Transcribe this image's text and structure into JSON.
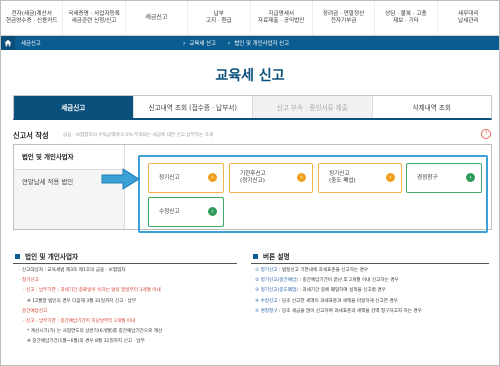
{
  "topnav": [
    {
      "line1": "전자(세금)계산서",
      "line2": "현금영수증 · 신용카드"
    },
    {
      "line1": "국세증명 · 사업자등록",
      "line2": "세금관련 신청/신고"
    },
    {
      "line1": "세금신고",
      "line2": ""
    },
    {
      "line1": "납부",
      "line2": "고지 · 환급"
    },
    {
      "line1": "지급명세서",
      "line2": "자료제출 · 공익법인"
    },
    {
      "line1": "장려금 · 연말정산",
      "line2": "전자기부금"
    },
    {
      "line1": "상담 · 불복 · 고충",
      "line2": "제보 · 기타"
    },
    {
      "line1": "세무대리",
      "line2": "납세관리"
    }
  ],
  "breadcrumb": {
    "home_icon": "home-icon",
    "items": [
      "세금신고",
      "교육세 신고",
      "법인 및 개인사업자 신고"
    ]
  },
  "page_title": "교육세 신고",
  "tabs": [
    {
      "label": "세금신고",
      "state": "active"
    },
    {
      "label": "신고내역 조회 (접수증 · 납부서)",
      "state": "normal"
    },
    {
      "label": "신고 부속 · 증빙서류 제출",
      "state": "disabled"
    },
    {
      "label": "삭제내역 조회",
      "state": "normal"
    }
  ],
  "section": {
    "title": "신고서 작성",
    "note": "금융 · 보험업자의 수익금액에 0.5% 부과되는 세금에 대한 신고 납부하는 조세",
    "help_icon": "?"
  },
  "sidebar": [
    {
      "label": "법인 및 개인사업자",
      "active": true
    },
    {
      "label": "연말납세 적용 법인",
      "active": false
    }
  ],
  "options": [
    {
      "line1": "정기신고",
      "line2": "",
      "color": "orange"
    },
    {
      "line1": "기한후신고",
      "line2": "(정기신고)",
      "color": "orange"
    },
    {
      "line1": "정기신고",
      "line2": "(중도 폐업)",
      "color": "orange"
    },
    {
      "line1": "경정청구",
      "line2": "",
      "color": "green"
    },
    {
      "line1": "수정신고",
      "line2": "",
      "color": "green"
    }
  ],
  "accent_colors": {
    "primary": "#0b4f7c",
    "orange": "#f0a020",
    "green": "#2f9a5a",
    "arrow": "#3aa0d6",
    "red": "#d43c2c"
  },
  "left_panel": {
    "title": "법인 및 개인사업자",
    "lines": [
      {
        "text": "· 신고대상자 : 교육세법 제3조 제1호의 금융 · 보험업자",
        "style": "normal"
      },
      {
        "text": "· 정기신고",
        "style": "red"
      },
      {
        "text": "- 신고 · 납부기한 : 과세기간 종료일이 속하는 달의 말일부터 3개월 이내",
        "style": "mixed"
      },
      {
        "text": "※ 12월말 법인의 경우 다음해 3월 31일까지 신고 · 납부",
        "style": "normal"
      },
      {
        "text": "· 중간예납신고",
        "style": "red"
      },
      {
        "text": "- 신고 · 납부기한 : 중간예납기간이 지난날부터 2개월 이내",
        "style": "mixed"
      },
      {
        "text": "* 계산시기(가) 는 사업연도의 상반기(6개월)를 중간예납기간으로 계산",
        "style": "normal"
      },
      {
        "text": "※ 중간예납기간(1월~6월)의 경우 8월 31일까지 신고 · 납부",
        "style": "normal"
      }
    ]
  },
  "right_panel": {
    "title": "버튼 설명",
    "lines": [
      {
        "key": "① 정기신고",
        "text": " : 법정신고 기한내에 과세표준을 신고하는 경우"
      },
      {
        "key": "② 정기신고(중간예납)",
        "text": " : 중간예납기간이 끝난 후 2개월 이내 신고하는 경우"
      },
      {
        "key": "③ 정기신고(중도폐업)",
        "text": " : 과세기간 중에 폐업하여 실적을 신고할 경우"
      },
      {
        "key": "④ 수정신고",
        "text": " : 당초 신고한 세액이 과세표준과 세액을 미달하게 신고한 경우"
      },
      {
        "key": "⑤ 경정청구",
        "text": " : 당초 세금을 많이 신고하여 과세표준과 세액을 감액 청구하고자 하는 경우"
      }
    ]
  }
}
